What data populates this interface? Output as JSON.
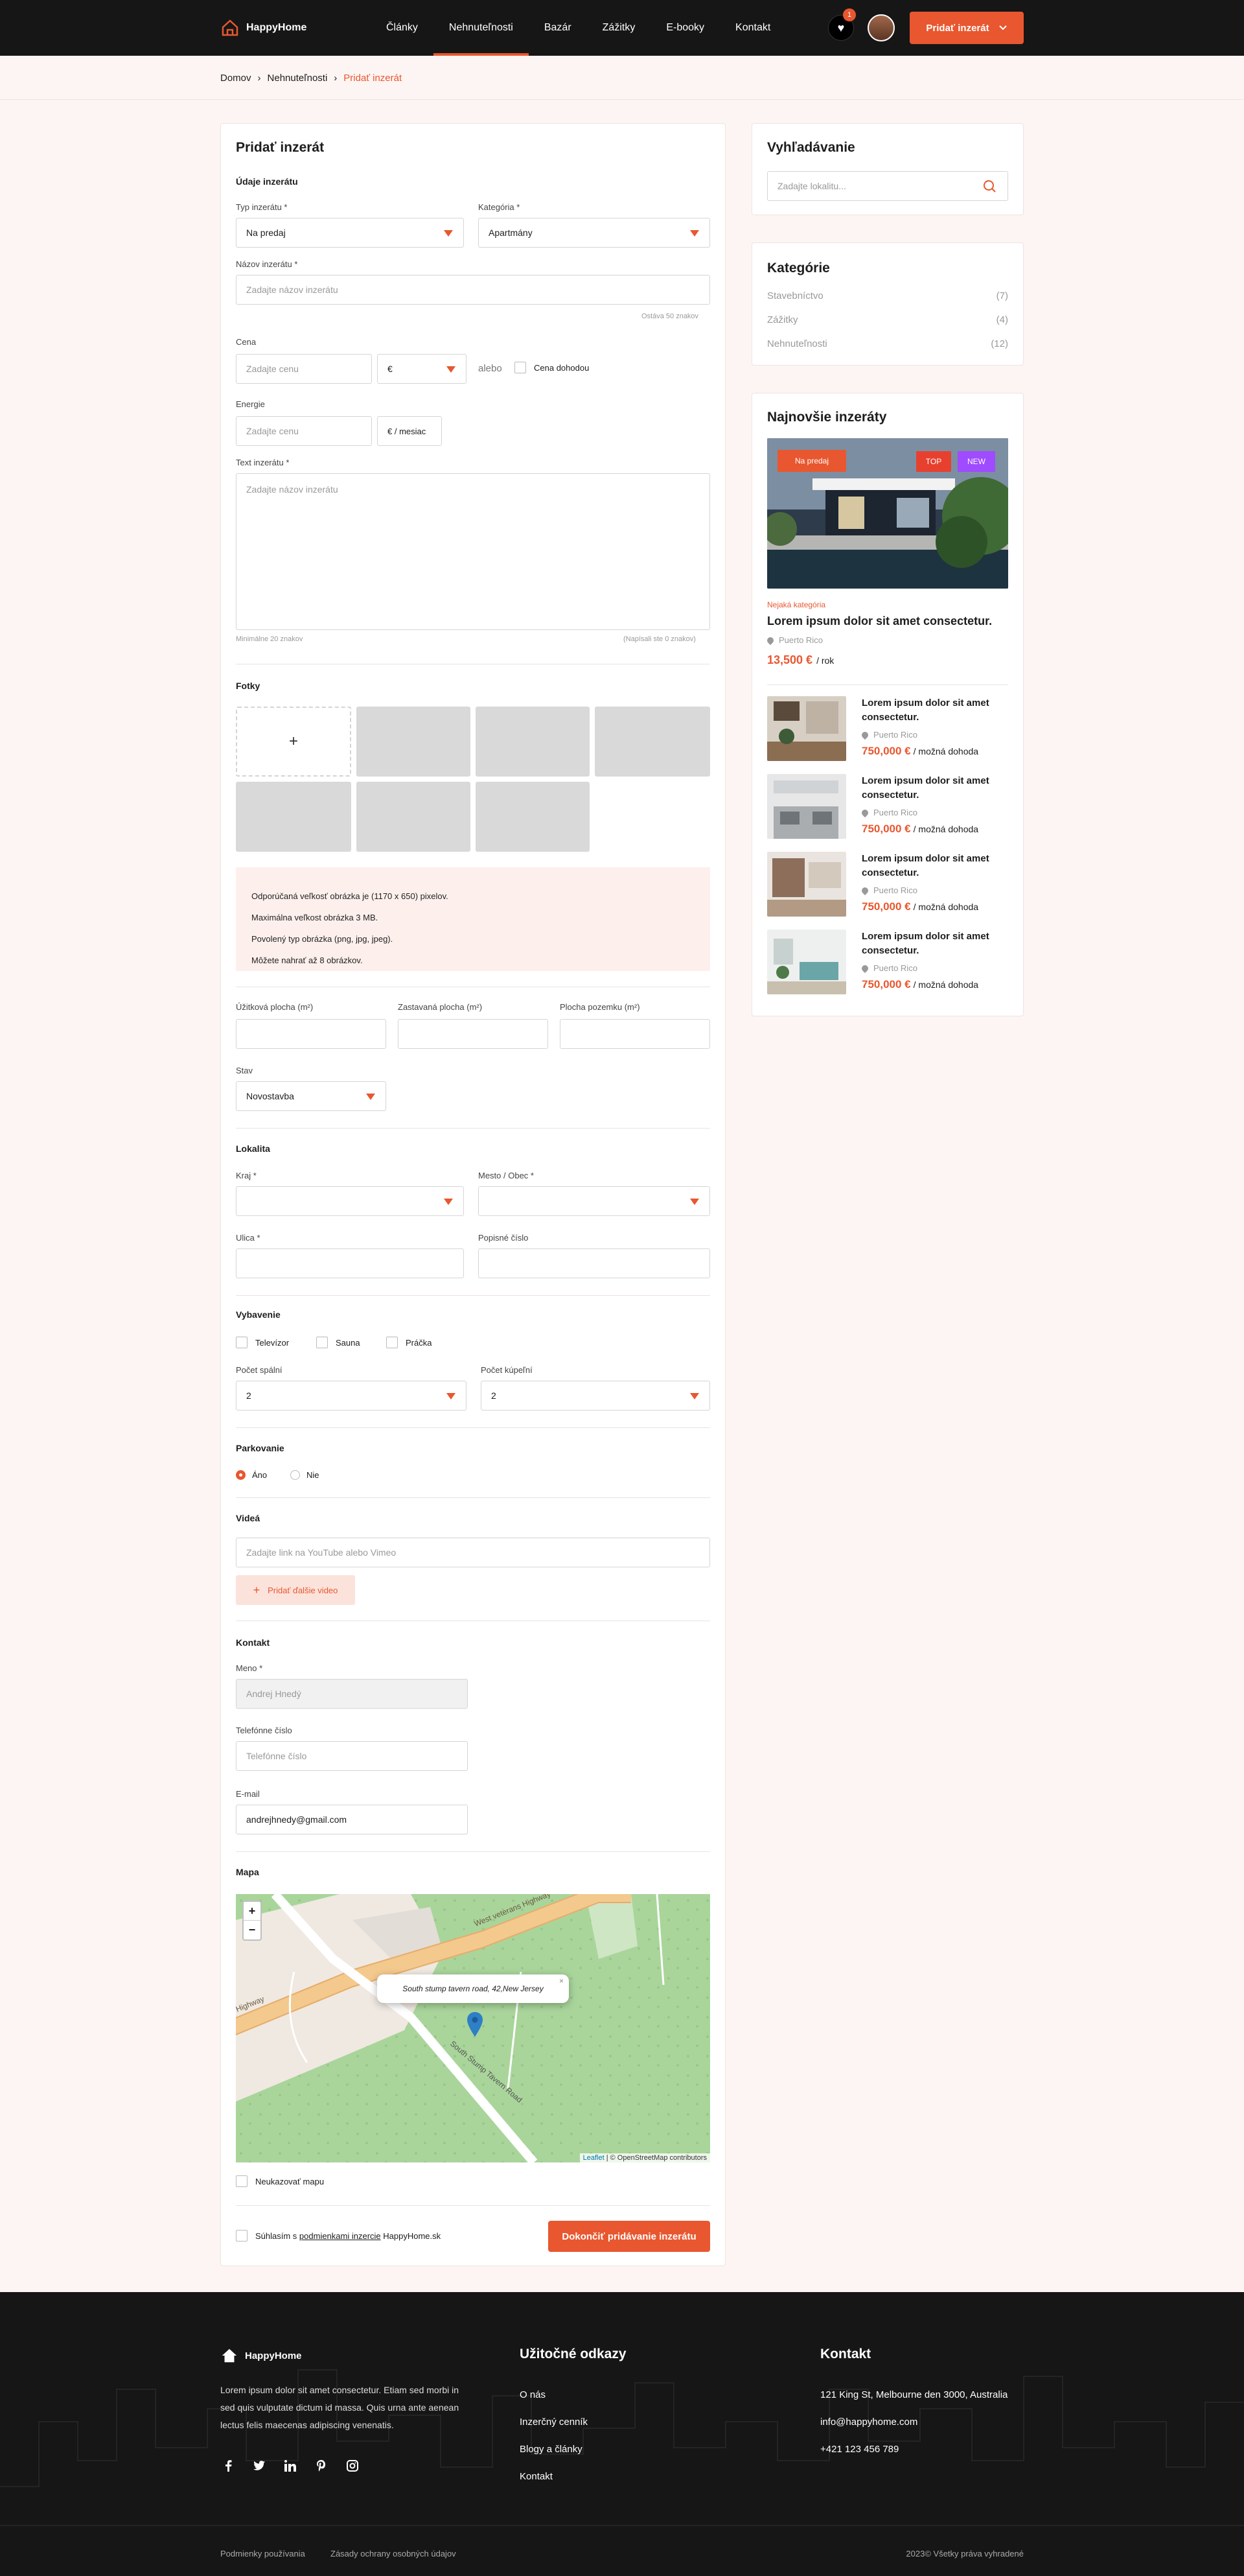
{
  "header": {
    "brand": "HappyHome",
    "nav": [
      "Články",
      "Nehnuteľnosti",
      "Bazár",
      "Zážitky",
      "E-booky",
      "Kontakt"
    ],
    "active_nav": "Nehnuteľnosti",
    "wishlist_count": "1",
    "add_button": "Pridať inzerát"
  },
  "breadcrumb": {
    "items": [
      "Domov",
      "Nehnuteľnosti"
    ],
    "current": "Pridať inzerát"
  },
  "form": {
    "title": "Pridať inzerát",
    "section_details": "Údaje inzerátu",
    "type_label": "Typ inzerátu *",
    "type_value": "Na predaj",
    "category_label": "Kategória *",
    "category_value": "Apartmány",
    "name_label": "Názov inzerátu *",
    "name_placeholder": "Zadajte názov inzerátu",
    "name_hint": "Ostáva 50 znakov",
    "price_label": "Cena",
    "price_placeholder": "Zadajte cenu",
    "currency_value": "€",
    "or_text": "alebo",
    "negotiable_label": "Cena dohodou",
    "energy_label": "Energie",
    "energy_placeholder": "Zadajte cenu",
    "energy_unit": "€ / mesiac",
    "text_label": "Text inzerátu *",
    "text_placeholder": "Zadajte názov inzerátu",
    "text_hint_min": "Minimálne 20 znakov",
    "text_hint_count": "(Napísali ste 0 znakov)",
    "photos_title": "Fotky",
    "upload_symbol": "+",
    "photo_info": [
      "Odporúčaná veľkosť obrázka je (1170 x 650) pixelov.",
      "Maximálna veľkost obrázka 3 MB.",
      "Povolený typ obrázka (png, jpg, jpeg).",
      "Môžete nahrať až 8 obrázkov."
    ],
    "usable_area_label": "Úžitková plocha (m²)",
    "built_area_label": "Zastavaná plocha (m²)",
    "land_area_label": "Plocha pozemku (m²)",
    "state_label": "Stav",
    "state_value": "Novostavba",
    "location_title": "Lokalita",
    "region_label": "Kraj *",
    "city_label": "Mesto / Obec *",
    "street_label": "Ulica *",
    "number_label": "Popisné číslo",
    "equipment_title": "Vybavenie",
    "equipment": [
      "Televízor",
      "Sauna",
      "Práčka"
    ],
    "bedrooms_label": "Počet spální",
    "bedrooms_value": "2",
    "bathrooms_label": "Počet kúpeľní",
    "bathrooms_value": "2",
    "parking_title": "Parkovanie",
    "parking_yes": "Áno",
    "parking_no": "Nie",
    "videos_title": "Videá",
    "video_placeholder": "Zadajte link na YouTube alebo Vimeo",
    "add_video": "Pridať ďalšie video",
    "contact_title": "Kontakt",
    "contact_name_label": "Meno *",
    "contact_name_value": "Andrej Hnedý",
    "phone_label": "Telefónne číslo",
    "phone_placeholder": "Telefónne číslo",
    "email_label": "E-mail",
    "email_value": "andrejhnedy@gmail.com",
    "map_title": "Mapa",
    "map_popup": "South stump tavern road, 42,New Jersey",
    "map_road_1": "West veterans Highway",
    "map_road_2": "South Stump Tavern Road",
    "map_road_3": "Highway",
    "zoom_in": "+",
    "zoom_out": "−",
    "attribution_leaflet": "Leaflet",
    "attribution_rest": "| © OpenStreetMap contributors",
    "hide_map_label": "Neukazovať mapu",
    "agree_prefix": "Súhlasím s ",
    "agree_link": "podmienkami inzercie",
    "agree_suffix": " HappyHome.sk",
    "submit": "Dokončiť pridávanie inzerátu"
  },
  "sidebar": {
    "search_title": "Vyhľadávanie",
    "search_placeholder": "Zadajte lokalitu...",
    "categories_title": "Kategórie",
    "categories": [
      {
        "name": "Stavebníctvo",
        "count": "(7)"
      },
      {
        "name": "Zážitky",
        "count": "(4)"
      },
      {
        "name": "Nehnuteľnosti",
        "count": "(12)"
      }
    ],
    "latest_title": "Najnovšie inzeráty",
    "featured": {
      "badge_sale": "Na predaj",
      "badge_top": "TOP",
      "badge_new": "NEW",
      "category": "Nejaká kategória",
      "location": "Puerto Rico",
      "title": "Lorem ipsum dolor sit amet consectetur.",
      "price": "13,500 €",
      "period": "/ rok"
    },
    "items": [
      {
        "title": "Lorem ipsum dolor sit amet consectetur.",
        "location": "Puerto Rico",
        "price": "750,000 €",
        "note": "/ možná dohoda"
      },
      {
        "title": "Lorem ipsum dolor sit amet consectetur.",
        "location": "Puerto Rico",
        "price": "750,000 €",
        "note": "/ možná dohoda"
      },
      {
        "title": "Lorem ipsum dolor sit amet consectetur.",
        "location": "Puerto Rico",
        "price": "750,000 €",
        "note": "/ možná dohoda"
      },
      {
        "title": "Lorem ipsum dolor sit amet consectetur.",
        "location": "Puerto Rico",
        "price": "750,000 €",
        "note": "/ možná dohoda"
      }
    ]
  },
  "footer": {
    "brand": "HappyHome",
    "about": "Lorem ipsum dolor sit amet consectetur. Etiam sed morbi in sed quis vulputate dictum id massa. Quis urna ante aenean lectus felis maecenas adipiscing venenatis.",
    "links_title": "Užitočné odkazy",
    "links": [
      "O nás",
      "Inzerčný cenník",
      "Blogy a články",
      "Kontakt"
    ],
    "contact_title": "Kontakt",
    "address": "121 King St, Melbourne den 3000, Australia",
    "email": "info@happyhome.com",
    "phone": "+421 123 456 789",
    "terms": "Podmienky používania",
    "privacy": "Zásady ochrany osobných údajov",
    "copyright": "2023© Všetky práva vyhradené"
  },
  "colors": {
    "accent": "#e8572f",
    "dark": "#161616",
    "bg": "#fdf5f3",
    "purple": "#9f4bff"
  }
}
